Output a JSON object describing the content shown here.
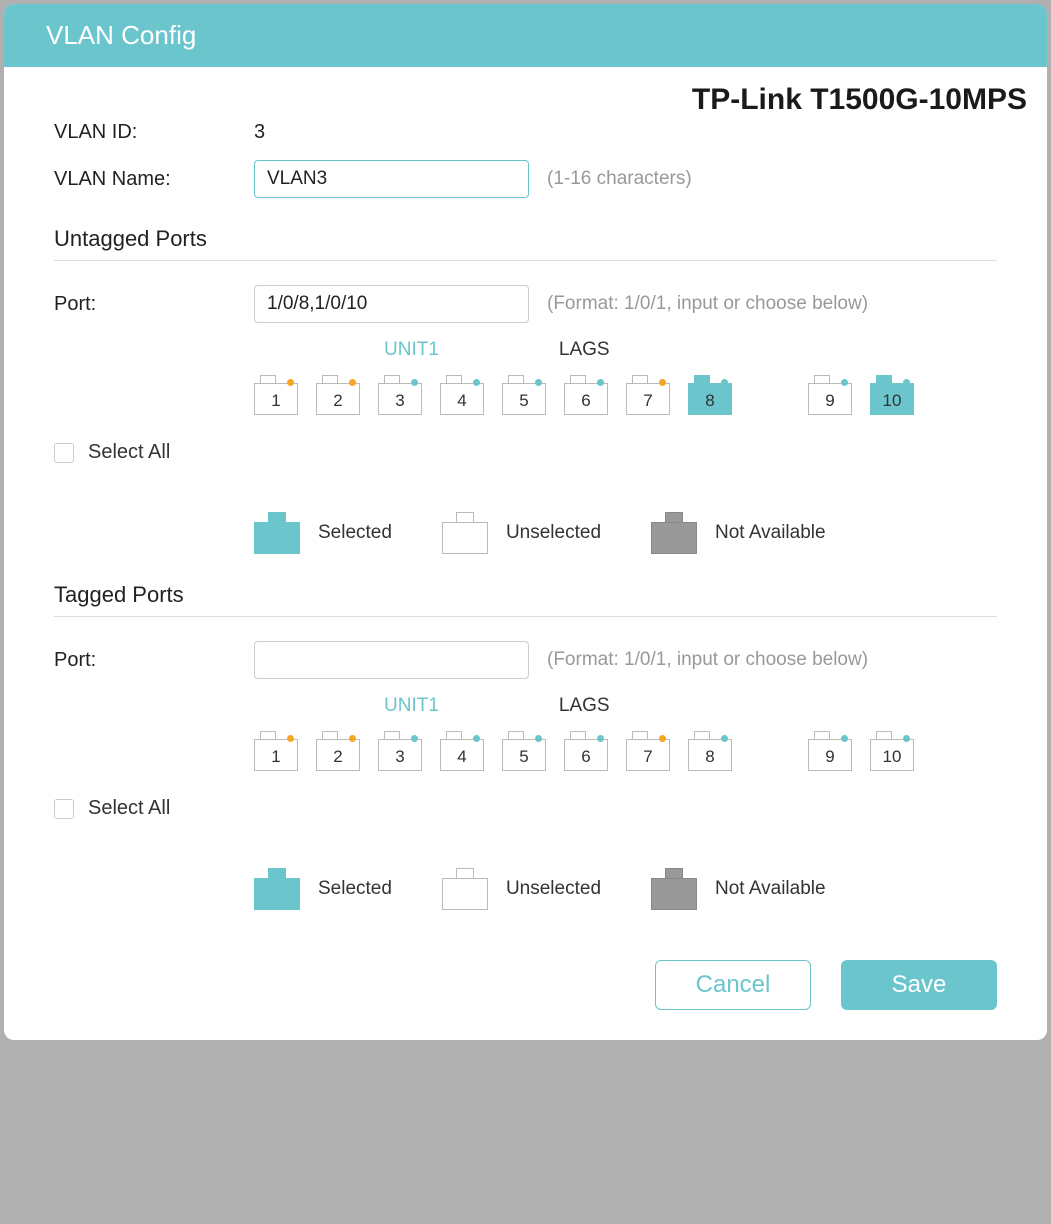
{
  "header": {
    "title": "VLAN Config"
  },
  "device": "TP-Link T1500G-10MPS",
  "vlan": {
    "id_label": "VLAN ID:",
    "id_value": "3",
    "name_label": "VLAN Name:",
    "name_value": "VLAN3",
    "name_hint": "(1-16 characters)"
  },
  "untagged": {
    "title": "Untagged Ports",
    "port_label": "Port:",
    "port_value": "1/0/8,1/0/10",
    "port_hint": "(Format: 1/0/1, input or choose below)",
    "tabs": {
      "unit": "UNIT1",
      "lags": "LAGS"
    },
    "select_all": "Select All",
    "ports": [
      {
        "n": "1",
        "dot": "orange",
        "sel": false
      },
      {
        "n": "2",
        "dot": "orange",
        "sel": false
      },
      {
        "n": "3",
        "dot": "teal",
        "sel": false
      },
      {
        "n": "4",
        "dot": "teal",
        "sel": false
      },
      {
        "n": "5",
        "dot": "teal",
        "sel": false
      },
      {
        "n": "6",
        "dot": "teal",
        "sel": false
      },
      {
        "n": "7",
        "dot": "orange",
        "sel": false
      },
      {
        "n": "8",
        "dot": "teal",
        "sel": true
      },
      {
        "n": "gap"
      },
      {
        "n": "9",
        "dot": "teal",
        "sel": false
      },
      {
        "n": "10",
        "dot": "teal",
        "sel": true
      }
    ]
  },
  "tagged": {
    "title": "Tagged Ports",
    "port_label": "Port:",
    "port_value": "",
    "port_hint": "(Format: 1/0/1, input or choose below)",
    "tabs": {
      "unit": "UNIT1",
      "lags": "LAGS"
    },
    "select_all": "Select All",
    "ports": [
      {
        "n": "1",
        "dot": "orange",
        "sel": false
      },
      {
        "n": "2",
        "dot": "orange",
        "sel": false
      },
      {
        "n": "3",
        "dot": "teal",
        "sel": false
      },
      {
        "n": "4",
        "dot": "teal",
        "sel": false
      },
      {
        "n": "5",
        "dot": "teal",
        "sel": false
      },
      {
        "n": "6",
        "dot": "teal",
        "sel": false
      },
      {
        "n": "7",
        "dot": "orange",
        "sel": false
      },
      {
        "n": "8",
        "dot": "teal",
        "sel": false
      },
      {
        "n": "gap"
      },
      {
        "n": "9",
        "dot": "teal",
        "sel": false
      },
      {
        "n": "10",
        "dot": "teal",
        "sel": false
      }
    ]
  },
  "legend": {
    "selected": "Selected",
    "unselected": "Unselected",
    "notavail": "Not Available"
  },
  "actions": {
    "cancel": "Cancel",
    "save": "Save"
  }
}
